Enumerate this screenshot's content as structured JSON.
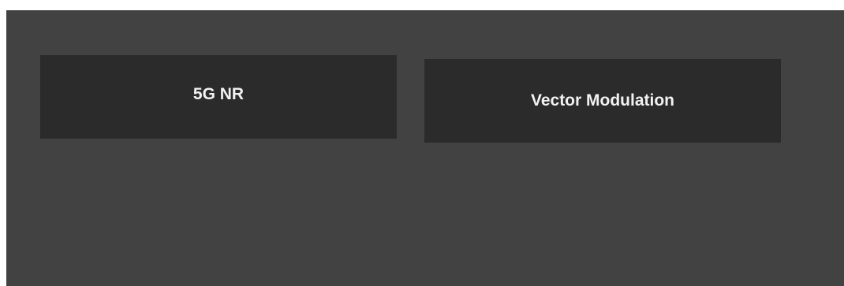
{
  "modes": {
    "nr5g_label": "5G NR",
    "vector_modulation_label": "Vector Modulation"
  },
  "colors": {
    "panel_background": "#424242",
    "button_background": "#2b2b2b",
    "button_text": "#f2f2f2"
  }
}
